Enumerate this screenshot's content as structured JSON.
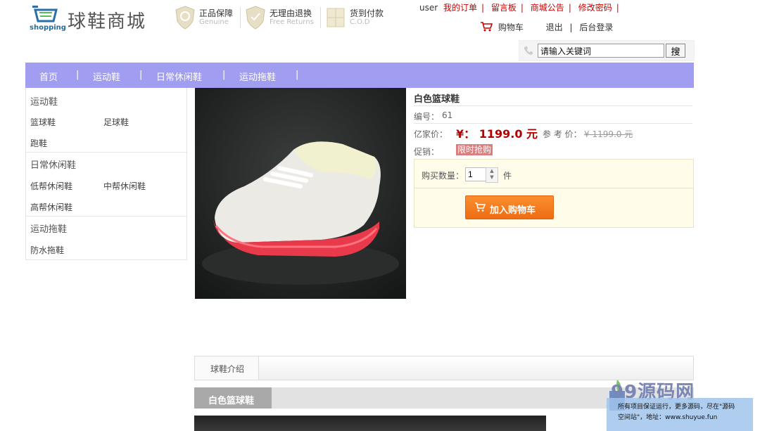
{
  "header": {
    "logo_word": "shopping",
    "store_name": "球鞋商城",
    "guarantees": [
      {
        "title": "正品保障",
        "subtitle": "Genuine"
      },
      {
        "title": "无理由退换",
        "subtitle": "Free Returns"
      },
      {
        "title": "货到付款",
        "subtitle": "C.O.D"
      }
    ],
    "user_links": {
      "username": "user",
      "items": [
        "我的订单",
        "留言板",
        "商城公告",
        "修改密码"
      ]
    },
    "cart_label": "购物车",
    "logout_label": "退出",
    "admin_label": "后台登录"
  },
  "search": {
    "value": "请输入关键词",
    "button": "搜"
  },
  "nav": {
    "items": [
      "首页",
      "运动鞋",
      "日常休闲鞋",
      "运动拖鞋"
    ]
  },
  "sidebar": {
    "categories": [
      {
        "title": "运动鞋",
        "items": [
          "篮球鞋",
          "足球鞋",
          "跑鞋"
        ]
      },
      {
        "title": "日常休闲鞋",
        "items": [
          "低帮休闲鞋",
          "中帮休闲鞋",
          "高帮休闲鞋"
        ]
      },
      {
        "title": "运动拖鞋",
        "items": [
          "防水拖鞋"
        ]
      }
    ]
  },
  "product": {
    "name": "白色篮球鞋",
    "id_label": "编号：",
    "id_value": "61",
    "price_label": "亿家价：",
    "price": "¥：  1199.0 元",
    "ref_label": "参 考 价：",
    "ref_price": "¥ 1199.0 元",
    "promo_label": "促销：",
    "promo_tag": "限时抢购",
    "qty_label": "购买数量：",
    "qty_value": "1",
    "qty_unit": "件",
    "add_to_cart": "加入购物车"
  },
  "tabs": {
    "intro": "球鞋介绍",
    "section_title": "白色篮球鞋"
  },
  "watermark": {
    "logo": "99源码网",
    "line1": "所有项目保证运行，更多源码，尽在\"源码",
    "line2": "空间站\"，地址：www.shuyue.fun"
  },
  "colors": {
    "nav_bg": "#a19ef1",
    "price_red": "#b40000",
    "cart_button": "#f47a1f"
  }
}
